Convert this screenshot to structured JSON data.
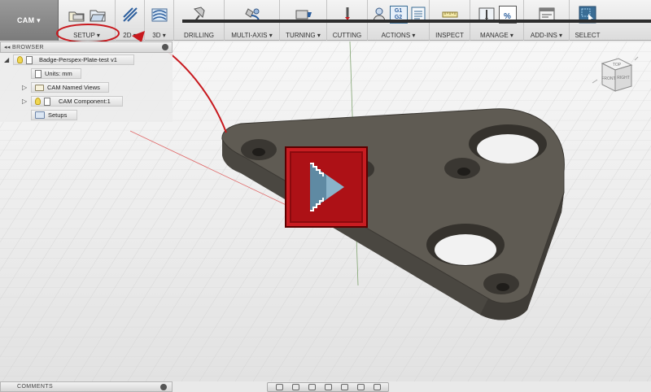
{
  "toolbar": {
    "workspace_label": "CAM ▾",
    "groups": [
      {
        "label": "SETUP ▾"
      },
      {
        "label": "2D ▾"
      },
      {
        "label": "3D ▾"
      },
      {
        "label": "DRILLING"
      },
      {
        "label": "MULTI-AXIS ▾"
      },
      {
        "label": "TURNING ▾"
      },
      {
        "label": "CUTTING"
      },
      {
        "label": "ACTIONS ▾"
      },
      {
        "label": "INSPECT"
      },
      {
        "label": "MANAGE ▾"
      },
      {
        "label": "ADD-INS ▾"
      },
      {
        "label": "SELECT"
      }
    ],
    "actions_g1": "G1",
    "actions_g2": "G2",
    "manage_percent": "%"
  },
  "browser": {
    "title": "BROWSER",
    "collapse_glyph": "◂◂",
    "root": "Badge-Perspex-Plate-test v1",
    "items": [
      {
        "label": "Units: mm"
      },
      {
        "label": "CAM Named Views"
      },
      {
        "label": "CAM Component:1"
      },
      {
        "label": "Setups"
      }
    ]
  },
  "viewcube": {
    "top": "TOP",
    "front": "FRONT",
    "right": "RIGHT"
  },
  "comments": {
    "title": "COMMENTS"
  },
  "colors": {
    "annotation_red": "#c8191e",
    "part_fill": "#5f5b53",
    "play_button": "#ad1116",
    "select_blue": "#3a6d95"
  }
}
